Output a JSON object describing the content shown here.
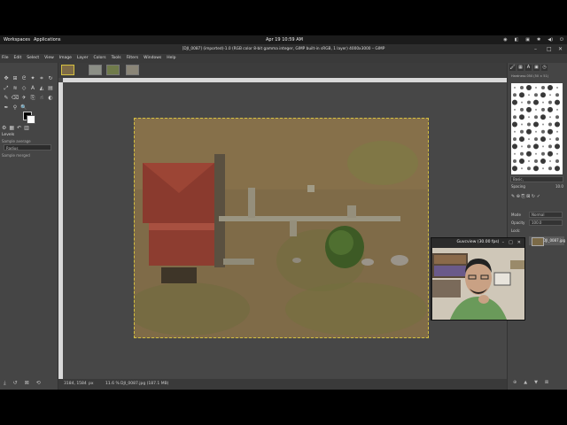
{
  "system_bar": {
    "workspaces": "Workspaces",
    "applications": "Applications",
    "clock": "Apr 19  10:59 AM",
    "tray": [
      "◉",
      "◧",
      "▣",
      "✱",
      "◀)",
      "⏻"
    ]
  },
  "window": {
    "title": "[DJI_0087] (imported)-1.0 (RGB color 8-bit gamma integer, GIMP built-in sRGB, 1 layer) 4000x3000 – GIMP",
    "controls": [
      "–",
      "□",
      "✕"
    ]
  },
  "menu": [
    "File",
    "Edit",
    "Select",
    "View",
    "Image",
    "Layer",
    "Colors",
    "Tools",
    "Filters",
    "Windows",
    "Help"
  ],
  "toolbox": {
    "icons": [
      {
        "name": "move-icon",
        "glyph": "✥"
      },
      {
        "name": "align-icon",
        "glyph": "⊞"
      },
      {
        "name": "lasso-icon",
        "glyph": "ᘓ"
      },
      {
        "name": "fuzzy-select-icon",
        "glyph": "✦"
      },
      {
        "name": "crop-icon",
        "glyph": "⌗"
      },
      {
        "name": "rotate-icon",
        "glyph": "↻"
      },
      {
        "name": "scale-icon",
        "glyph": "⤢"
      },
      {
        "name": "warp-icon",
        "glyph": "≋"
      },
      {
        "name": "cage-icon",
        "glyph": "◇"
      },
      {
        "name": "text-icon",
        "glyph": "A"
      },
      {
        "name": "bucket-fill-icon",
        "glyph": "◭"
      },
      {
        "name": "gradient-icon",
        "glyph": "▤"
      },
      {
        "name": "paintbrush-icon",
        "glyph": "✎"
      },
      {
        "name": "eraser-icon",
        "glyph": "⌫"
      },
      {
        "name": "airbrush-icon",
        "glyph": "✈"
      },
      {
        "name": "clone-icon",
        "glyph": "⎘"
      },
      {
        "name": "smudge-icon",
        "glyph": "☝"
      },
      {
        "name": "dodge-icon",
        "glyph": "◐"
      },
      {
        "name": "paths-icon",
        "glyph": "✒"
      },
      {
        "name": "color-picker-icon",
        "glyph": "⚲"
      },
      {
        "name": "zoom-icon",
        "glyph": "🔍"
      }
    ]
  },
  "tool_options": {
    "tabs": [
      "⚙",
      "▦",
      "↶",
      "▥"
    ],
    "title": "Levels",
    "sample_average": "Sample average",
    "radius": "Radius",
    "sample_merged": "Sample merged"
  },
  "image_tabs": [
    "img1",
    "img2",
    "img3",
    "img4"
  ],
  "status": {
    "coords": "3184, 1584",
    "unit": "px",
    "zoom": "11.6 %",
    "file": "DJI_0087.jpg (187.1 MB)"
  },
  "right_panel": {
    "tabs": [
      "🖌",
      "▦",
      "A",
      "▣",
      "◷"
    ],
    "brush_header": "Hardness 050 (50 × 51)",
    "filter": "Basic,",
    "spacing_label": "Spacing",
    "spacing_value": "10.0",
    "mode_label": "Mode",
    "mode_value": "Normal",
    "lock_label": "Lock:",
    "opacity_label": "Opacity",
    "opacity_value": "100.0",
    "layer_name": "DJI_0087.jpg"
  },
  "guvcview": {
    "title": "Guvcview  (30.00 fps)",
    "controls": [
      "–",
      "□",
      "✕"
    ]
  },
  "colors": {
    "accent": "#d4c040"
  }
}
